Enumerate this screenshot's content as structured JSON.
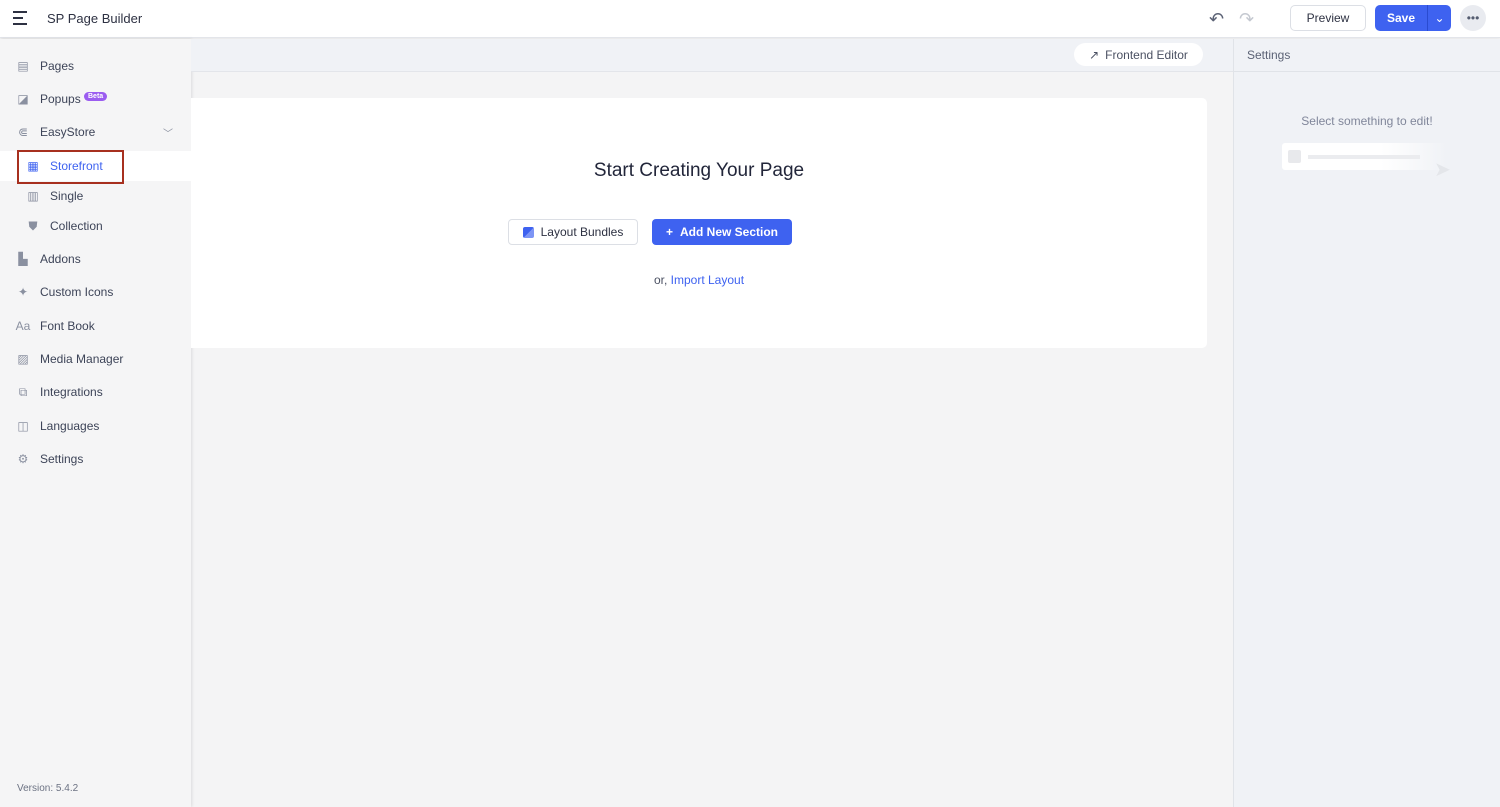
{
  "header": {
    "title": "SP Page Builder",
    "preview": "Preview",
    "save": "Save"
  },
  "sidebar": {
    "items": [
      {
        "label": "Pages",
        "icon": "pages-icon"
      },
      {
        "label": "Popups",
        "icon": "popups-icon",
        "badge": "Beta"
      },
      {
        "label": "EasyStore",
        "icon": "easystore-icon"
      },
      {
        "label": "Storefront",
        "icon": "storefront-icon"
      },
      {
        "label": "Single",
        "icon": "single-icon"
      },
      {
        "label": "Collection",
        "icon": "collection-icon"
      },
      {
        "label": "Addons",
        "icon": "addons-icon"
      },
      {
        "label": "Custom Icons",
        "icon": "custom-icons-icon"
      },
      {
        "label": "Font Book",
        "icon": "font-book-icon"
      },
      {
        "label": "Media Manager",
        "icon": "media-manager-icon"
      },
      {
        "label": "Integrations",
        "icon": "integrations-icon"
      },
      {
        "label": "Languages",
        "icon": "languages-icon"
      },
      {
        "label": "Settings",
        "icon": "gear-icon"
      }
    ],
    "version": "Version: 5.4.2"
  },
  "canvas": {
    "frontend_editor": "Frontend Editor",
    "heading": "Start Creating Your Page",
    "layout_bundles": "Layout Bundles",
    "add_section": "Add New Section",
    "or": "or,",
    "import": "Import Layout"
  },
  "settings": {
    "title": "Settings",
    "empty": "Select something to edit!"
  }
}
